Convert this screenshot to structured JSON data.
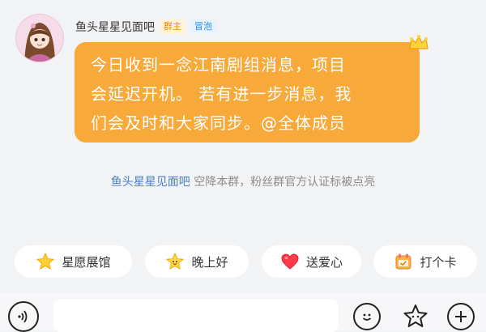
{
  "message": {
    "sender_name": "鱼头星星见面吧",
    "badges": {
      "owner": "群主",
      "bubble": "冒泡"
    },
    "text": "今日收到一念江南剧组消息，项目\n会延迟开机。 若有进一步消息，我\n们会及时和大家同步。@全体成员",
    "bubble_color": "#f7a93a"
  },
  "system_notice": {
    "name": "鱼头星星见面吧",
    "text": " 空降本群，粉丝群官方认证标被点亮"
  },
  "quick_actions": [
    {
      "label": "星愿展馆",
      "icon": "star-icon"
    },
    {
      "label": "晚上好",
      "icon": "smiling-star-icon"
    },
    {
      "label": "送爱心",
      "icon": "heart-icon"
    },
    {
      "label": "打个卡",
      "icon": "checkin-card-icon"
    }
  ],
  "input_bar": {
    "placeholder": "",
    "icons": [
      "voice-icon",
      "emoji-icon",
      "super-emoji-icon",
      "plus-icon"
    ]
  },
  "colors": {
    "background": "#f2f3f5",
    "accent_orange": "#f7a93a",
    "link_blue": "#4a7fc1",
    "owner_badge": "#f08a00",
    "bubble_badge": "#2a8cf0"
  }
}
